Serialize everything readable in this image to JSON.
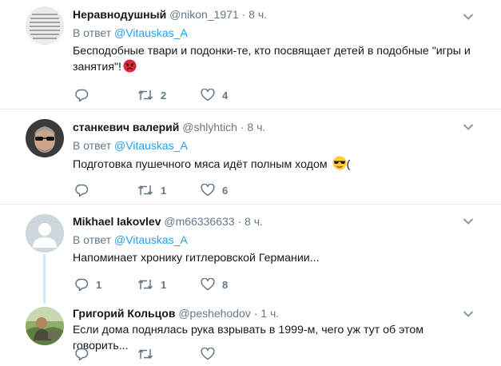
{
  "reply_prefix": "В ответ",
  "tweets": [
    {
      "name": "Неравнодушный",
      "handle": "@nikon_1971",
      "dot": "·",
      "time": "8 ч.",
      "reply_to": "@Vitauskas_A",
      "text": "Бесподобные твари и подонки-те, кто посвящает детей в подобные \"игры и занятия\"!",
      "emoji": "angry-face-emoji",
      "counts": {
        "reply": "",
        "retweet": "2",
        "like": "4"
      }
    },
    {
      "name": "станкевич валерий",
      "handle": "@shlyhtich",
      "dot": "·",
      "time": "8 ч.",
      "reply_to": "@Vitauskas_A",
      "text": "Подготовка пушечного мяса идёт полным ходом",
      "text_after": "(",
      "emoji": "sunglasses-face-emoji",
      "counts": {
        "reply": "",
        "retweet": "1",
        "like": "6"
      }
    },
    {
      "name": "Mikhael Iakovlev",
      "handle": "@m66336633",
      "dot": "·",
      "time": "8 ч.",
      "reply_to": "@Vitauskas_A",
      "text": "Напоминает хронику гитлеровской Германии...",
      "counts": {
        "reply": "1",
        "retweet": "1",
        "like": "8"
      }
    },
    {
      "name": "Григорий Кольцов",
      "handle": "@peshehodov",
      "dot": "·",
      "time": "1 ч.",
      "text": "Если дома поднялась рука взрывать в 1999-м, чего уж тут об этом говорить...",
      "counts": {
        "reply": "",
        "retweet": "",
        "like": ""
      }
    }
  ],
  "colors": {
    "link": "#1da1f2",
    "muted": "#657786",
    "text": "#14171a",
    "divider": "#e6ecf0"
  }
}
